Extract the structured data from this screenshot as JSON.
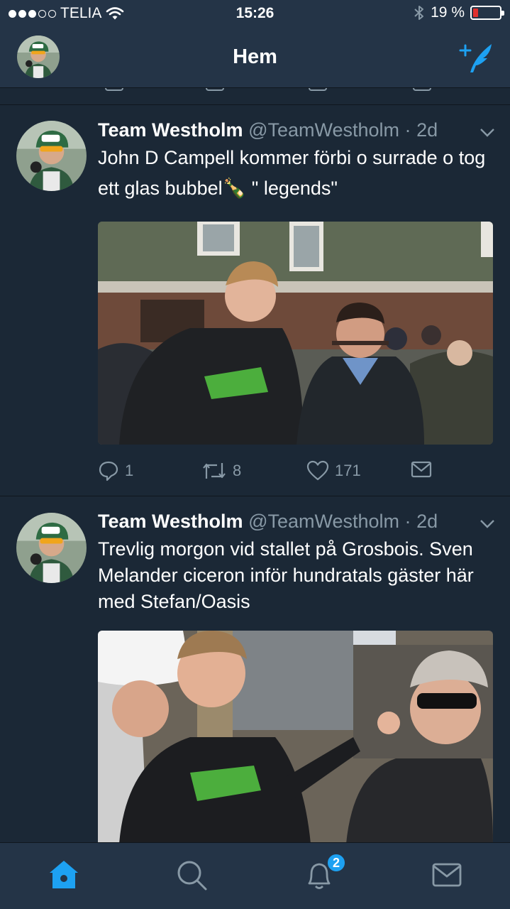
{
  "status_bar": {
    "carrier": "TELIA",
    "time": "15:26",
    "battery": "19 %",
    "battery_level": 0.19,
    "signal_bars": 3
  },
  "nav": {
    "title": "Hem",
    "compose_icon": "compose-tweet-icon"
  },
  "tweets": [
    {
      "name": "Team Westholm",
      "handle": "@TeamWestholm",
      "separator": "·",
      "age": "2d",
      "text": "John D Campell kommer förbi o surrade o tog ett glas bubbel🍾 \" legends\"",
      "replies": "1",
      "retweets": "8",
      "likes": "171"
    },
    {
      "name": "Team Westholm",
      "handle": "@TeamWestholm",
      "separator": "·",
      "age": "2d",
      "text": "Trevlig morgon vid stallet på Grosbois. Sven Melander ciceron inför hundratals gäster här med  Stefan/Oasis"
    }
  ],
  "tab_bar": {
    "tabs": [
      "home-icon",
      "search-icon",
      "notifications-icon",
      "messages-icon"
    ],
    "notifications_badge": "2",
    "active_color": "#1da1f2"
  },
  "colors": {
    "background": "#1b2836",
    "bar": "#243447",
    "secondary_text": "#8899a6",
    "accent": "#1da1f2"
  }
}
